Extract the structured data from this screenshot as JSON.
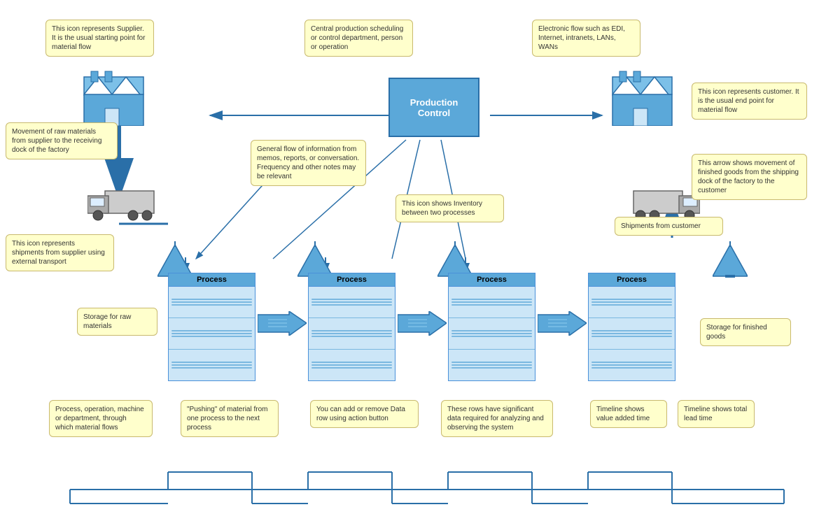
{
  "callouts": {
    "supplier_icon": "This icon represents Supplier. It is the usual starting point for material flow",
    "production_control_icon": "Central production scheduling or control department, person or operation",
    "electronic_flow": "Electronic flow such as EDI, Internet, intranets, LANs, WANs",
    "customer_icon": "This icon represents customer. It is the usual end point for material flow",
    "raw_material_movement": "Movement of raw materials from supplier to the receiving dock of the factory",
    "general_flow": "General flow of information from memos, reports, or conversation. Frequency and other notes may be relevant",
    "inventory_icon": "This icon shows Inventory between two processes",
    "finished_goods_arrow": "This arrow shows movement of finished goods from the shipping dock of the factory to the customer",
    "supplier_transport": "This icon represents shipments from supplier using external transport",
    "shipments_customer": "Shipments from customer",
    "raw_materials_storage": "Storage for raw materials",
    "finished_goods_storage": "Storage for finished goods",
    "process_box": "Process, operation, machine or department, through which material flows",
    "push_arrow": "\"Pushing\" of material from one process to the next process",
    "data_row": "You can add or remove Data row using action button",
    "data_rows_info": "These rows have significant data required for analyzing and observing the system",
    "timeline_value": "Timeline shows value added time",
    "timeline_lead": "Timeline shows total lead time"
  },
  "production_control_label": "Production Control",
  "process_label": "Process"
}
